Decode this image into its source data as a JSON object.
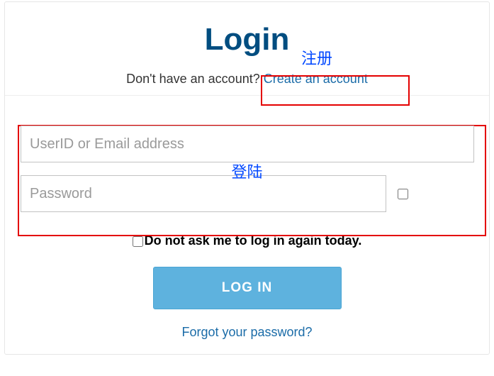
{
  "title": "Login",
  "annotations": {
    "register": "注册",
    "login": "登陆"
  },
  "subline": {
    "prompt": "Don't have an account? ",
    "create": "Create an account"
  },
  "fields": {
    "user_placeholder": "UserID or Email address",
    "password_placeholder": "Password"
  },
  "persist_label": "Do not ask me to log in again today.",
  "login_button": "LOG IN",
  "forgot": "Forgot your password?"
}
